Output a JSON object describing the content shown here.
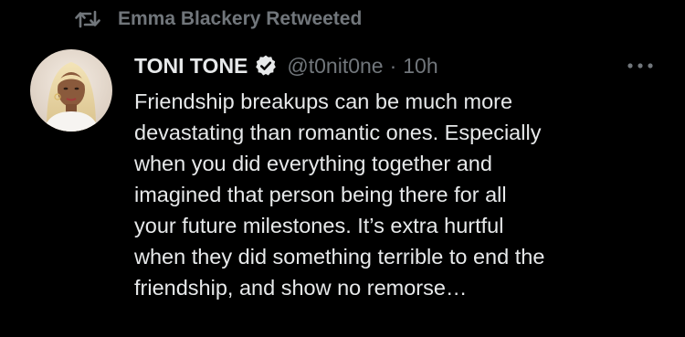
{
  "retweet": {
    "icon": "retweet-icon",
    "label": "Emma Blackery Retweeted"
  },
  "tweet": {
    "author_name": "TONI TONE",
    "verified_icon": "verified-badge-icon",
    "handle": "@t0nit0ne",
    "separator": "·",
    "time": "10h",
    "more_icon": "more-horizontal-icon",
    "lines": [
      "Friendship breakups can be much more",
      "devastating than romantic ones. Especially",
      "when you did everything together and",
      "imagined that person being there for all",
      "your future milestones. It’s extra hurtful",
      "when they did something terrible to end the",
      "friendship, and show no remorse…"
    ]
  },
  "colors": {
    "background": "#000000",
    "primary_text": "#e7e9ea",
    "secondary_text": "#71767b",
    "verified_blue": "#1d9bf0"
  }
}
